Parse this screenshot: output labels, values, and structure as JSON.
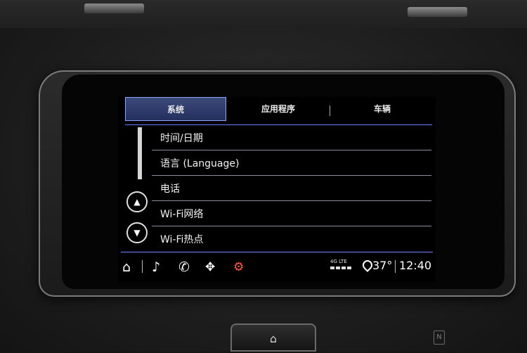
{
  "tabs": [
    {
      "label": "系统",
      "active": true
    },
    {
      "label": "应用程序",
      "active": false
    },
    {
      "label": "车辆",
      "active": false
    }
  ],
  "menu": {
    "items": [
      {
        "label": "时间/日期"
      },
      {
        "label": "语言 (Language)"
      },
      {
        "label": "电话"
      },
      {
        "label": "Wi-Fi网络"
      },
      {
        "label": "Wi-Fi热点"
      }
    ]
  },
  "status": {
    "network": "4G LTE",
    "temperature": "37°",
    "time": "12:40"
  },
  "icons": {
    "home": "⌂",
    "music": "♪",
    "phone": "✆",
    "nav": "✥",
    "apps": "⚙",
    "arrow_up": "▲",
    "arrow_down": "▼",
    "hw_home": "⌂",
    "nfc": "N"
  },
  "colors": {
    "accent": "#6a7cff",
    "tab_active": "#2c3a6c"
  }
}
